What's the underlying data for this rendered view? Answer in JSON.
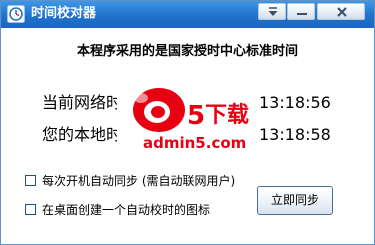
{
  "window": {
    "title": "时间校对器",
    "controls": {
      "dropdown_icon": "chevron-down-icon",
      "minimize_icon": "minimize-icon",
      "close_icon": "close-icon"
    }
  },
  "main": {
    "header": "本程序采用的是国家授时中心标准时间",
    "network_time": {
      "label": "当前网络时间",
      "value": "13:18:56"
    },
    "local_time": {
      "label": "您的本地时间",
      "value": "13:18:58"
    }
  },
  "options": [
    {
      "label": "每次开机自动同步 (需自动联网用户)",
      "checked": false
    },
    {
      "label": "在桌面创建一个自动校时的图标",
      "checked": false
    }
  ],
  "actions": {
    "sync_now": "立即同步"
  },
  "watermark": {
    "logo_text": "a5下载",
    "url_text": "admin5.com"
  },
  "colors": {
    "titlebar": "#1f73cc",
    "watermark_red": "#e60012"
  }
}
